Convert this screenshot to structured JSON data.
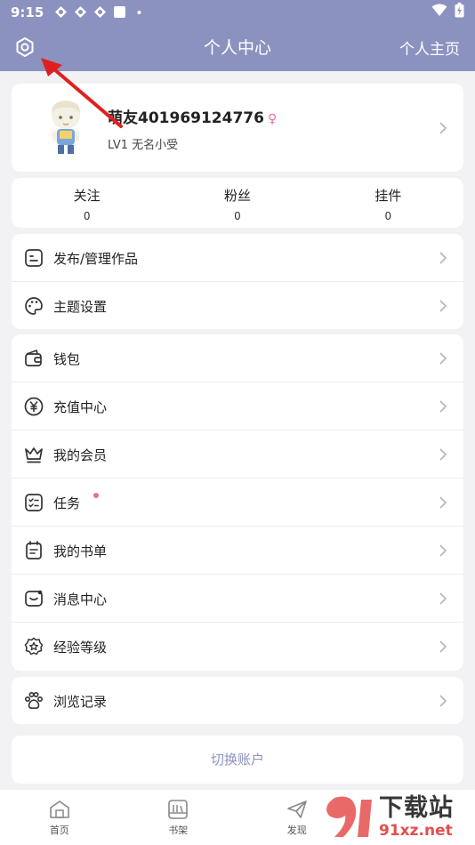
{
  "status_bar": {
    "time": "9:15"
  },
  "header": {
    "title": "个人中心",
    "homepage_label": "个人主页"
  },
  "profile": {
    "username": "萌友401969124776",
    "gender_symbol": "♀",
    "level": "LV1 无名小受"
  },
  "stats": [
    {
      "label": "关注",
      "value": "0"
    },
    {
      "label": "粉丝",
      "value": "0"
    },
    {
      "label": "挂件",
      "value": "0"
    }
  ],
  "menu_group_1": [
    {
      "label": "发布/管理作品",
      "icon": "publish-icon"
    },
    {
      "label": "主题设置",
      "icon": "palette-icon"
    }
  ],
  "menu_group_2": [
    {
      "label": "钱包",
      "icon": "wallet-icon"
    },
    {
      "label": "充值中心",
      "icon": "yuan-icon"
    },
    {
      "label": "我的会员",
      "icon": "crown-icon"
    },
    {
      "label": "任务",
      "icon": "task-icon",
      "badge_dot": true
    },
    {
      "label": "我的书单",
      "icon": "booklist-icon"
    },
    {
      "label": "消息中心",
      "icon": "message-icon"
    },
    {
      "label": "经验等级",
      "icon": "star-badge-icon"
    }
  ],
  "menu_group_3": [
    {
      "label": "浏览记录",
      "icon": "paw-icon"
    }
  ],
  "switch_account_label": "切换账户",
  "tabbar": [
    {
      "label": "首页",
      "icon": "home-icon"
    },
    {
      "label": "书架",
      "icon": "bookshelf-icon"
    },
    {
      "label": "发现",
      "icon": "paper-plane-icon"
    }
  ],
  "watermark": {
    "title": "下载站",
    "url": "91xz.net"
  },
  "colors": {
    "header": "#8c92bf",
    "accent_pink": "#ec6fa5",
    "arrow": "#e02020"
  }
}
